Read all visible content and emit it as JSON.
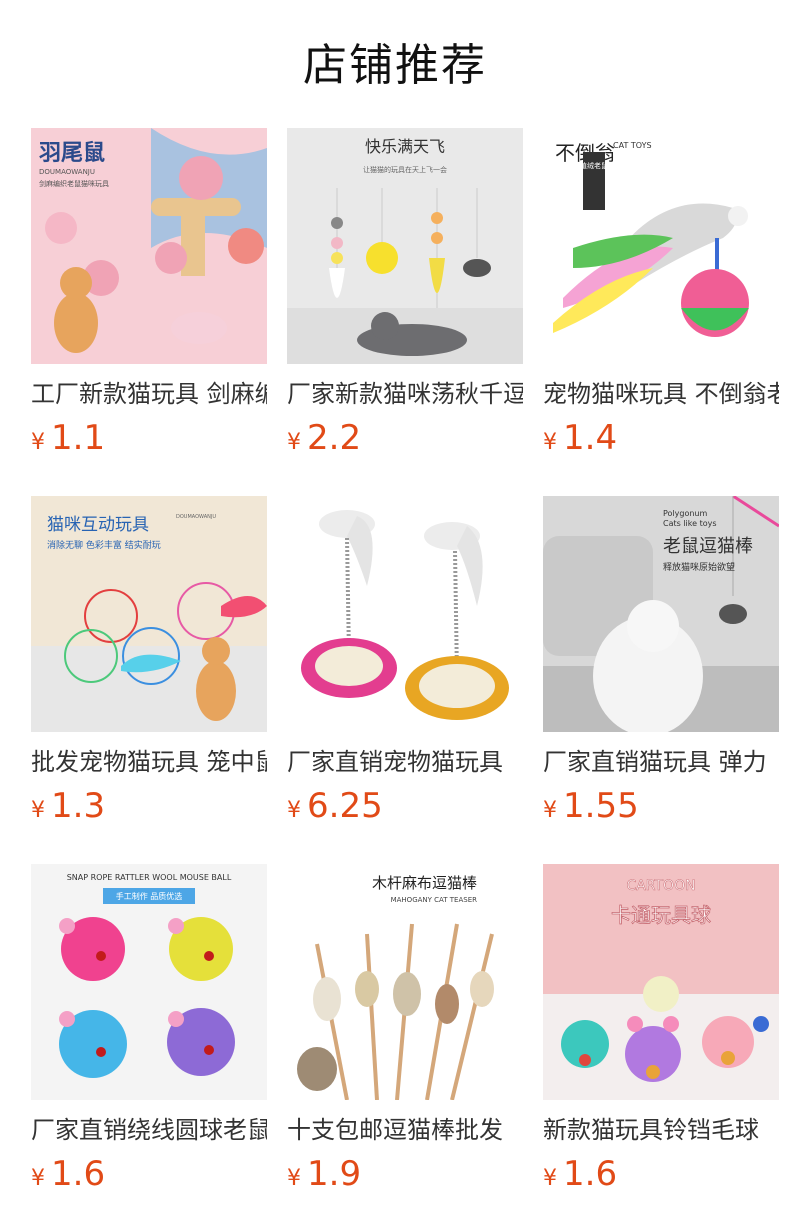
{
  "header": {
    "title": "店铺推荐"
  },
  "products": [
    {
      "name": "工厂新款猫玩具 剑麻编织老鼠",
      "currency": "¥",
      "price": "1.1",
      "image": {
        "heading": "羽尾鼠",
        "sub": "DOUMAOWANJU",
        "sub2": "剑麻编织老鼠猫咪玩具",
        "bg": "#f7cfd6"
      }
    },
    {
      "name": "厂家新款猫咪荡秋千逗猫",
      "currency": "¥",
      "price": "2.2",
      "image": {
        "heading": "快乐满天飞",
        "sub": "让猫猫的玩具在天上飞一会",
        "bg": "#e9e9e9"
      }
    },
    {
      "name": "宠物猫咪玩具 不倒翁老鼠",
      "currency": "¥",
      "price": "1.4",
      "image": {
        "heading": "不倒翁",
        "sub": "CAT TOYS",
        "sub2": "植绒老鼠",
        "bg": "#ffffff"
      }
    },
    {
      "name": "批发宠物猫玩具 笼中鼠",
      "currency": "¥",
      "price": "1.3",
      "image": {
        "heading": "猫咪互动玩具",
        "sub": "DOUMAOWANJU",
        "sub2": "消除无聊  色彩丰富  结实耐玩",
        "bg": "#f1e7d6"
      }
    },
    {
      "name": "厂家直销宠物猫玩具",
      "currency": "¥",
      "price": "6.25",
      "image": {
        "bg": "#ffffff"
      }
    },
    {
      "name": "厂家直销猫玩具 弹力",
      "currency": "¥",
      "price": "1.55",
      "image": {
        "heading": "老鼠逗猫棒",
        "sub": "Polygonum",
        "sub2": "Cats like toys",
        "sub3": "释放猫咪原始欲望",
        "bg": "#d8d8d8"
      }
    },
    {
      "name": "厂家直销绕线圆球老鼠",
      "currency": "¥",
      "price": "1.6",
      "image": {
        "heading": "SNAP ROPE RATTLER WOOL MOUSE BALL",
        "sub": "手工制作  品质优选",
        "bg": "#f4f4f4"
      }
    },
    {
      "name": "十支包邮逗猫棒批发",
      "currency": "¥",
      "price": "1.9",
      "image": {
        "heading": "木杆麻布逗猫棒",
        "sub": "MAHOGANY CAT TEASER",
        "bg": "#ffffff"
      }
    },
    {
      "name": "新款猫玩具铃铛毛球",
      "currency": "¥",
      "price": "1.6",
      "image": {
        "heading": "CARTOON",
        "sub": "卡通玩具球",
        "bg": "#f2c1c3"
      }
    }
  ]
}
